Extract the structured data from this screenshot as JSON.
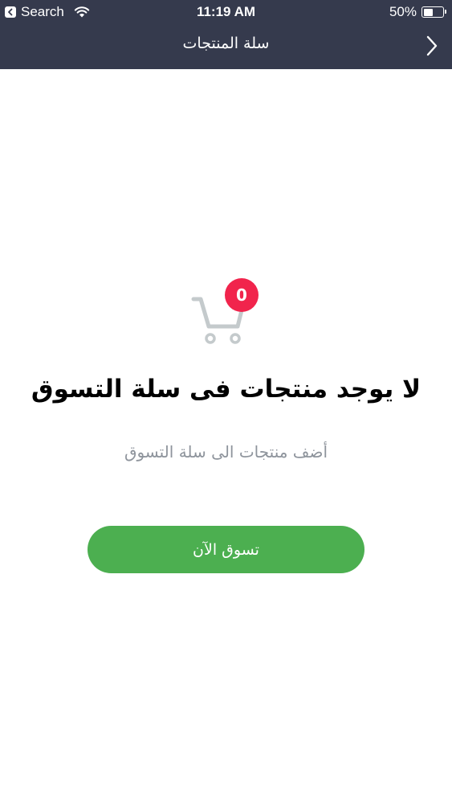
{
  "status_bar": {
    "back_app_label": "Search",
    "time": "11:19 AM",
    "battery_percent_label": "50%",
    "battery_level": 0.5
  },
  "nav": {
    "title": "سلة المنتجات"
  },
  "empty_cart": {
    "badge_count": "0",
    "title": "لا يوجد منتجات فى سلة التسوق",
    "subtitle": "أضف منتجات الى سلة التسوق",
    "button_label": "تسوق الآن"
  },
  "colors": {
    "header_bg": "#353a4d",
    "badge": "#f1244c",
    "button": "#4caf50",
    "subtitle": "#8e949c",
    "cart_icon": "#c4cacc"
  },
  "icons": {
    "back_app": "chevron-left-icon",
    "wifi": "wifi-icon",
    "battery": "battery-icon",
    "nav_back": "chevron-right-icon",
    "cart": "shopping-cart-icon"
  }
}
